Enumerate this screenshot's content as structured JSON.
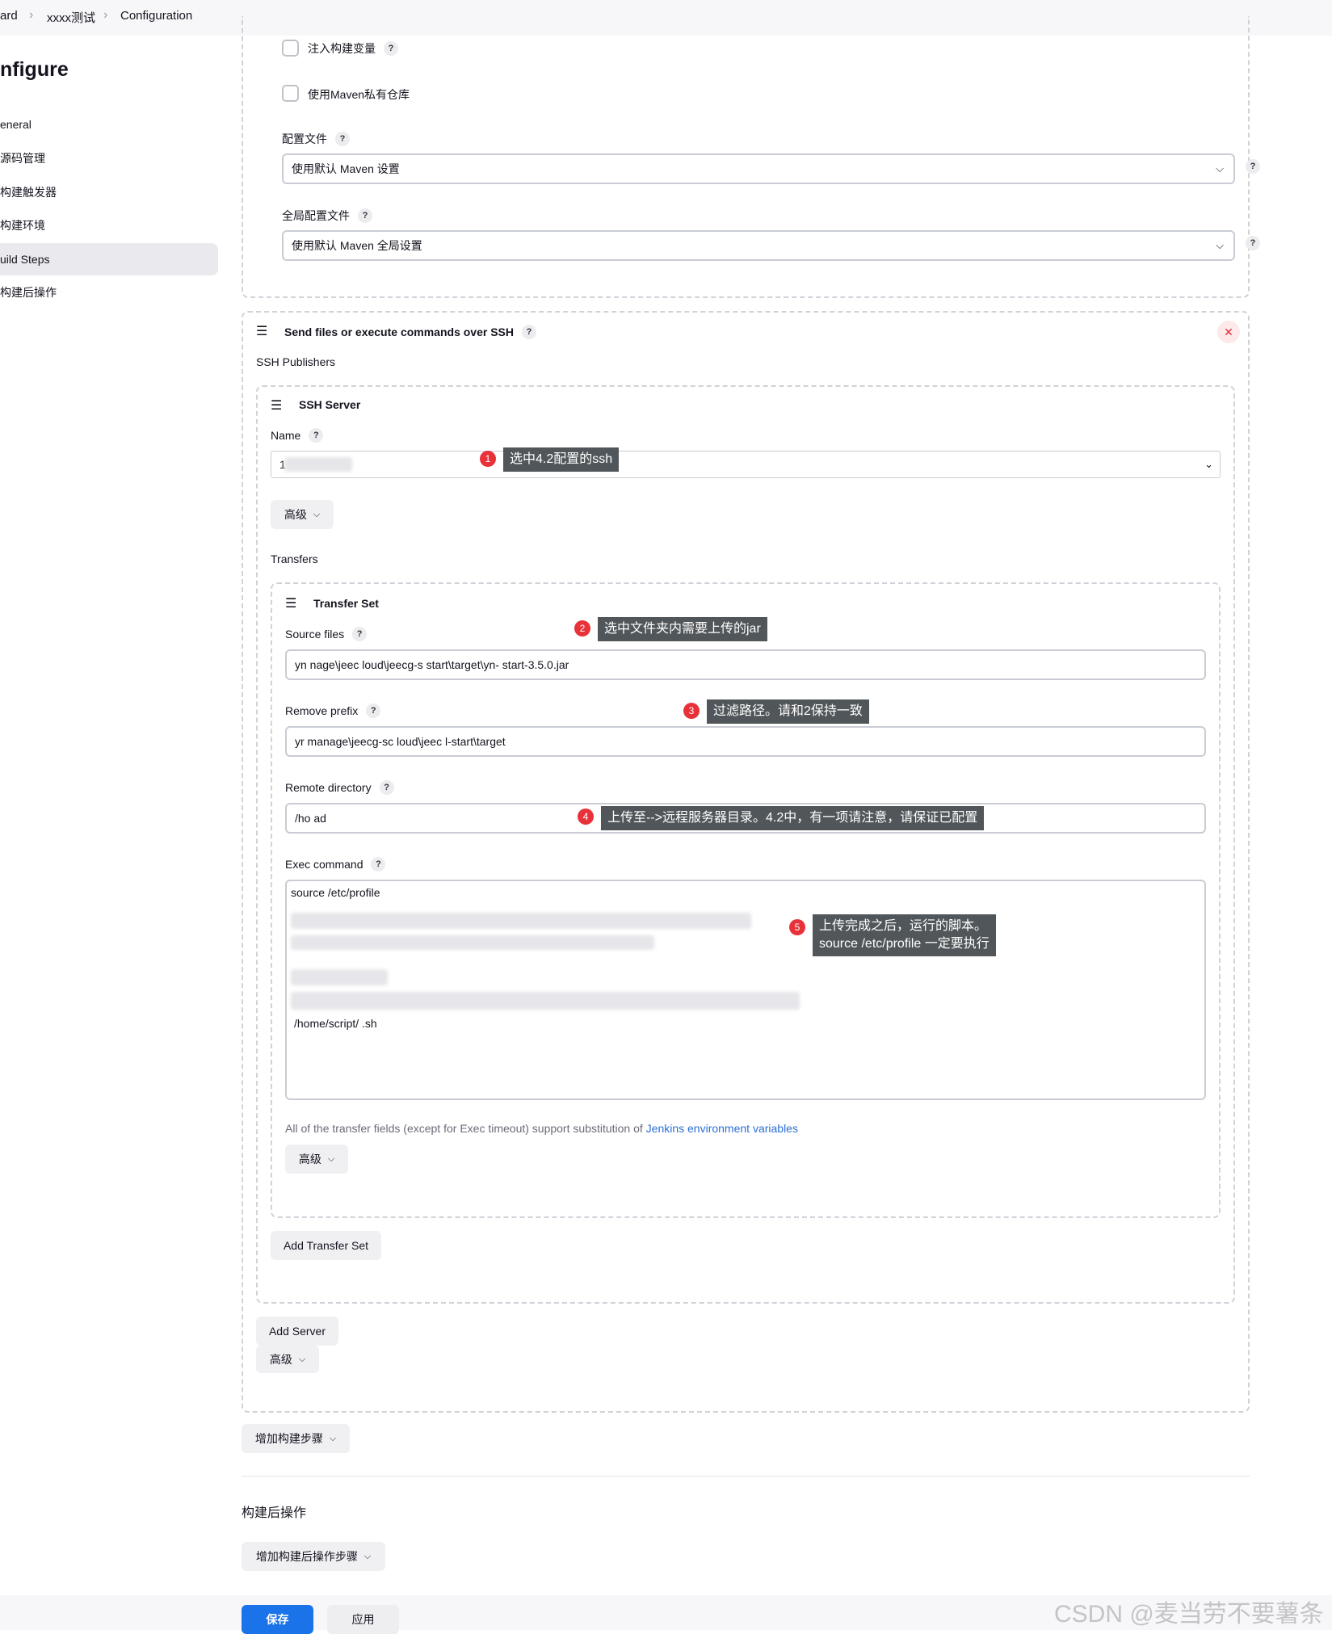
{
  "breadcrumb": [
    "ard",
    "xxxx测试",
    "Configuration"
  ],
  "sidebar": {
    "title": "nfigure",
    "items": [
      "eneral",
      "源码管理",
      "构建触发器",
      "构建环境",
      "uild Steps",
      "构建后操作"
    ]
  },
  "maven": {
    "inject_label": "注入构建变量",
    "private_repo_label": "使用Maven私有仓库",
    "settings_label": "配置文件",
    "settings_value": "使用默认 Maven 设置",
    "global_label": "全局配置文件",
    "global_value": "使用默认 Maven 全局设置"
  },
  "ssh": {
    "title": "Send files or execute commands over SSH",
    "publishers_label": "SSH Publishers",
    "server_title": "SSH Server",
    "name_label": "Name",
    "name_value": "1",
    "advanced_label": "高级",
    "transfers_label": "Transfers",
    "transfer_set_title": "Transfer Set",
    "source_label": "Source files",
    "source_value": "yn   nage\\jeec   loud\\jeecg-s    start\\target\\yn-   start-3.5.0.jar",
    "remove_prefix_label": "Remove prefix",
    "remove_prefix_value": "yr   manage\\jeecg-sc   loud\\jeec   l-start\\target",
    "remote_dir_label": "Remote directory",
    "remote_dir_value": "/ho   ad",
    "exec_label": "Exec command",
    "exec_line1": "source /etc/profile",
    "exec_line_last": "/home/script/   .sh",
    "transfer_note": "All of the transfer fields (except for Exec timeout) support substitution of ",
    "transfer_note_link": "Jenkins environment variables",
    "transfer_advanced": "高级",
    "add_transfer_set": "Add Transfer Set",
    "add_server": "Add Server",
    "server_advanced": "高级"
  },
  "callouts": [
    {
      "n": "1",
      "text": "选中4.2配置的ssh"
    },
    {
      "n": "2",
      "text": "选中文件夹内需要上传的jar"
    },
    {
      "n": "3",
      "text": "过滤路径。请和2保持一致"
    },
    {
      "n": "4",
      "text": "上传至-->远程服务器目录。4.2中，有一项请注意，请保证已配置"
    },
    {
      "n": "5",
      "text_line1": "上传完成之后，运行的脚本。",
      "text_line2": "source /etc/profile 一定要执行"
    }
  ],
  "add_build_step": "增加构建步骤",
  "post_build": {
    "title": "构建后操作",
    "add_label": "增加构建后操作步骤"
  },
  "footer": {
    "save": "保存",
    "apply": "应用",
    "watermark": "CSDN @麦当劳不要薯条"
  },
  "colors": {
    "accent": "#1a73e8",
    "callout_badge": "#e8323a",
    "callout_bg": "#505659",
    "danger": "#d92b38"
  }
}
